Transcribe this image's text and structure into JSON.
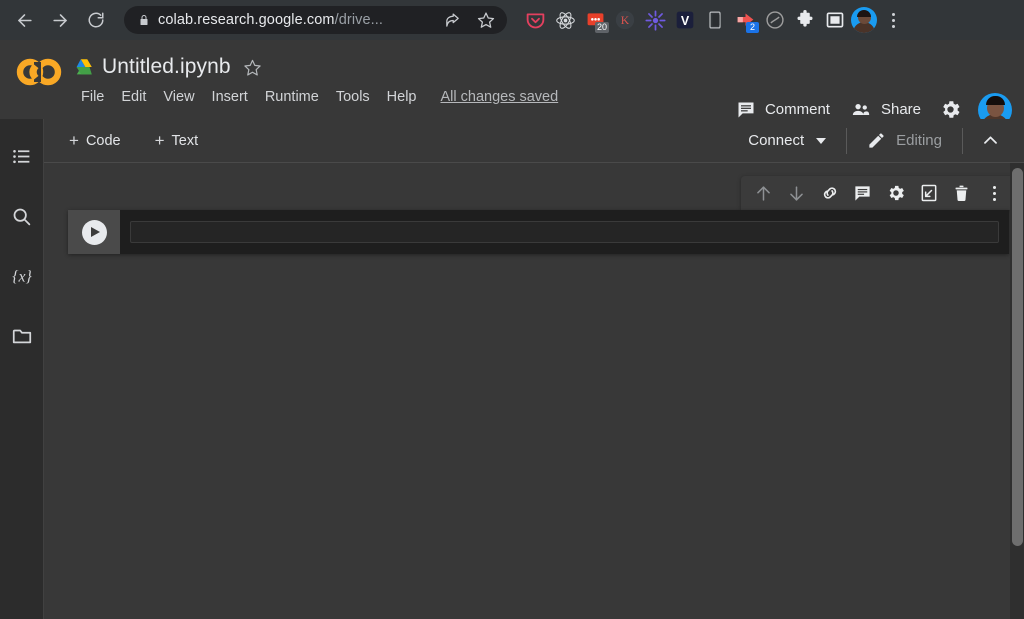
{
  "browser": {
    "nav": {
      "back": "back-arrow",
      "forward": "forward-arrow",
      "reload": "reload"
    },
    "omnibox": {
      "lock": "lock-icon",
      "url_main": "colab.research.google.com",
      "url_path": "/drive...",
      "share_icon": "share-icon",
      "bookmark_icon": "star-icon"
    },
    "extensions": [
      {
        "name": "pocket-extension",
        "glyph": "",
        "color": "#e4405f",
        "badge": null
      },
      {
        "name": "react-devtools-extension",
        "glyph": "",
        "color": "#d7dadd",
        "badge": null
      },
      {
        "name": "notifications-extension",
        "glyph": "",
        "color": "#e8402a",
        "badge": "20",
        "badge_style": "gray"
      },
      {
        "name": "k-extension",
        "glyph": "K",
        "color": "#d9534f",
        "badge": null
      },
      {
        "name": "asterisk-extension",
        "glyph": "",
        "color": "#6f5ae0",
        "badge": null
      },
      {
        "name": "v-extension",
        "glyph": "V",
        "color": "#ffffff",
        "badge": null
      },
      {
        "name": "mobile-view-extension",
        "glyph": "",
        "color": "#b9bcbf",
        "badge": null
      },
      {
        "name": "video-download-extension",
        "glyph": "",
        "color": "#ef5350",
        "badge": "2",
        "badge_style": "blue"
      },
      {
        "name": "adblock-extension",
        "glyph": "",
        "color": "#9e9e9e",
        "badge": null
      },
      {
        "name": "extensions-puzzle-icon",
        "glyph": "",
        "color": "#e8eaed",
        "badge": null
      },
      {
        "name": "sidepanel-icon",
        "glyph": "",
        "color": "#e8eaed",
        "badge": null
      }
    ],
    "profile": "profile-avatar",
    "menu": "browser-menu"
  },
  "colab": {
    "logo": "colab-logo",
    "drive_icon": "google-drive-icon",
    "doc_title": "Untitled.ipynb",
    "star": "star-icon",
    "menu_items": [
      "File",
      "Edit",
      "View",
      "Insert",
      "Runtime",
      "Tools",
      "Help"
    ],
    "save_status": "All changes saved",
    "comment_label": "Comment",
    "share_label": "Share",
    "settings": "gear-icon",
    "account": "account-avatar"
  },
  "toolbar": {
    "add_code": "Code",
    "add_text": "Text",
    "plus": "+",
    "connect_label": "Connect",
    "editing_label": "Editing",
    "collapse": "chevron-up-icon"
  },
  "sidebar": {
    "items": [
      {
        "name": "table-of-contents-icon",
        "label": "Table of contents"
      },
      {
        "name": "search-icon",
        "label": "Find and replace"
      },
      {
        "name": "variables-icon",
        "label": "{x}"
      },
      {
        "name": "files-icon",
        "label": "Files"
      }
    ]
  },
  "cell": {
    "run_button": "run-cell-button",
    "code_value": "",
    "code_placeholder": "",
    "toolbar_buttons": [
      {
        "name": "move-cell-up-icon",
        "state": "disabled"
      },
      {
        "name": "move-cell-down-icon",
        "state": "disabled"
      },
      {
        "name": "link-to-cell-icon",
        "state": "enabled"
      },
      {
        "name": "add-comment-icon",
        "state": "enabled"
      },
      {
        "name": "cell-settings-icon",
        "state": "enabled"
      },
      {
        "name": "mirror-cell-icon",
        "state": "enabled"
      },
      {
        "name": "delete-cell-icon",
        "state": "enabled"
      },
      {
        "name": "more-cell-actions-icon",
        "state": "enabled"
      }
    ]
  },
  "colors": {
    "browser_chrome": "#323639",
    "omnibox": "#202124",
    "colab_bg": "#383838",
    "sidebar_bg": "#2c2c2c",
    "cell_bg": "#1e1e1e",
    "gutter": "#4a4a4a",
    "accent_orange": "#f9a825",
    "accent_blue": "#1a73e8"
  }
}
